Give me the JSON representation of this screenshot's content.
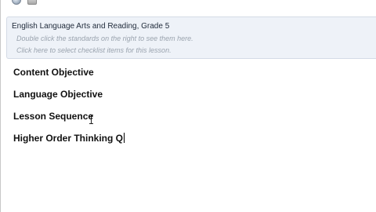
{
  "toolbar": {
    "icons": [
      "info-circle-icon",
      "copy-pages-icon"
    ]
  },
  "standards": {
    "title": "English Language Arts and Reading, Grade 5",
    "hint_standards": "Double click the standards on the right to see them here.",
    "hint_checklist": "Click here to select checklist items for this lesson."
  },
  "sections": {
    "content_objective": "Content Objective",
    "language_objective": "Language Objective",
    "lesson_sequence": "Lesson Sequence",
    "higher_order": "Higher Order Thinking Q"
  }
}
